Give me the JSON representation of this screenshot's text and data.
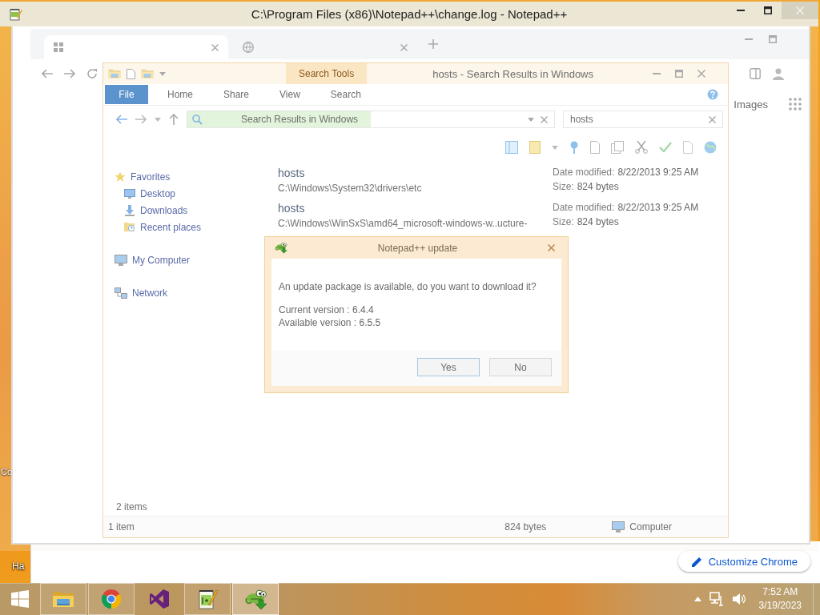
{
  "notepad_window": {
    "title": "C:\\Program Files (x86)\\Notepad++\\change.log - Notepad++"
  },
  "chrome_window": {
    "header_links": [
      "Images"
    ],
    "customize_button": "Customize Chrome"
  },
  "explorer_window": {
    "title": "hosts - Search Results in Windows",
    "contextual_tab": "Search Tools",
    "ribbon_tabs": [
      {
        "label": "File",
        "kind": "menu"
      },
      {
        "label": "Home",
        "kind": "tab"
      },
      {
        "label": "Share",
        "kind": "tab"
      },
      {
        "label": "View",
        "kind": "tab"
      },
      {
        "label": "Search",
        "kind": "tab"
      }
    ],
    "address": "Search Results in Windows",
    "search_progress": {
      "level": 0.5
    },
    "search_box": {
      "value": "hosts"
    },
    "nav": [
      {
        "label": "Favorites",
        "kind": "favorites",
        "children": [
          {
            "label": "Desktop",
            "kind": "desktop"
          },
          {
            "label": "Downloads",
            "kind": "downloads"
          },
          {
            "label": "Recent places",
            "kind": "recent"
          }
        ]
      },
      {
        "label": "My Computer",
        "kind": "computer"
      },
      {
        "label": "Network",
        "kind": "network"
      }
    ],
    "results": [
      {
        "name": "hosts",
        "path": "C:\\Windows\\System32\\drivers\\etc",
        "date_label": "Date modified:",
        "date": "8/22/2013 9:25 AM",
        "size_label": "Size:",
        "size": "824 bytes"
      },
      {
        "name": "hosts",
        "path": "C:\\Windows\\WinSxS\\amd64_microsoft-windows-w..ucture-",
        "date_label": "Date modified:",
        "date": "8/22/2013 9:25 AM",
        "size_label": "Size:",
        "size": "824 bytes"
      }
    ],
    "status": "2 items",
    "details_bar": {
      "count": "1 item",
      "size": "824 bytes",
      "location": "Computer"
    }
  },
  "update_dialog": {
    "title": "Notepad++ update",
    "message": "An update package is available, do you want to download it?",
    "versions": [
      "Current version : 6.4.4",
      "Available version : 6.5.5"
    ],
    "buttons": [
      "Yes",
      "No"
    ]
  },
  "desktop": {
    "icon_labels": [
      "Co",
      "Ha"
    ]
  },
  "taskbar": {
    "apps": [
      {
        "kind": "explorer",
        "running": true,
        "selected": false
      },
      {
        "kind": "chrome",
        "running": true,
        "selected": false
      },
      {
        "kind": "visual-studio",
        "running": false,
        "selected": false
      },
      {
        "kind": "notepad-plus-plus",
        "running": true,
        "selected": false
      },
      {
        "kind": "updater",
        "running": true,
        "selected": true
      }
    ],
    "clock": {
      "time": "7:52 AM",
      "date": "3/19/2023"
    }
  }
}
